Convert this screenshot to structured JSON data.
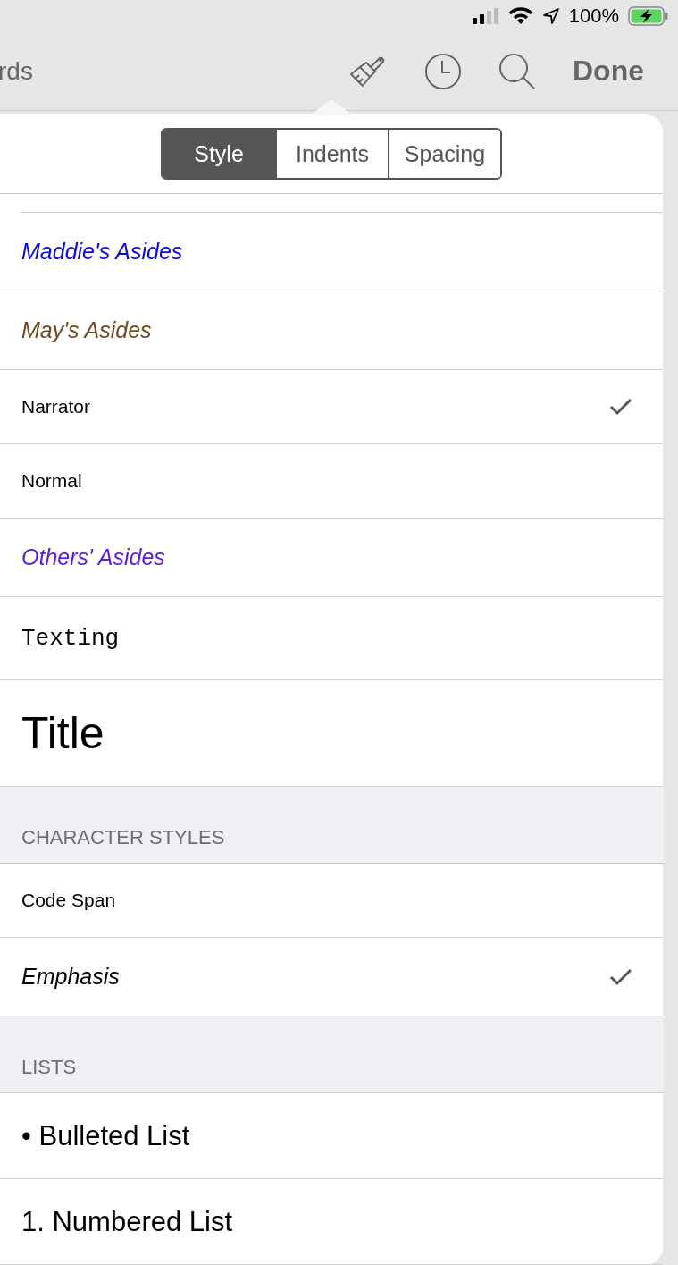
{
  "status_bar": {
    "battery": "100%"
  },
  "toolbar": {
    "back_label": "rds",
    "done": "Done"
  },
  "tabs": [
    {
      "label": "Style",
      "selected": true
    },
    {
      "label": "Indents",
      "selected": false
    },
    {
      "label": "Spacing",
      "selected": false
    }
  ],
  "sections": [
    {
      "rows": [
        {
          "label": "Maddie's Asides",
          "kind": "italic",
          "color": "#0a0ad8",
          "checked": false
        },
        {
          "label": "May's Asides",
          "kind": "italic",
          "color": "#6e4a22",
          "checked": false
        },
        {
          "label": "Narrator",
          "kind": "plain",
          "checked": true
        },
        {
          "label": "Normal",
          "kind": "plain",
          "checked": false
        },
        {
          "label": "Others' Asides",
          "kind": "italic",
          "color": "#5b1fe0",
          "checked": false
        },
        {
          "label": "Texting",
          "kind": "mono",
          "checked": false
        },
        {
          "label": "Title",
          "kind": "title",
          "checked": false
        }
      ]
    },
    {
      "header": "CHARACTER STYLES",
      "rows": [
        {
          "label": "Code Span",
          "kind": "plain",
          "checked": false
        },
        {
          "label": "Emphasis",
          "kind": "italic",
          "checked": true
        }
      ]
    },
    {
      "header": "LISTS",
      "rows": [
        {
          "label": "• Bulleted List",
          "kind": "list",
          "checked": false
        },
        {
          "label": "1. Numbered List",
          "kind": "list",
          "checked": false
        }
      ]
    }
  ]
}
